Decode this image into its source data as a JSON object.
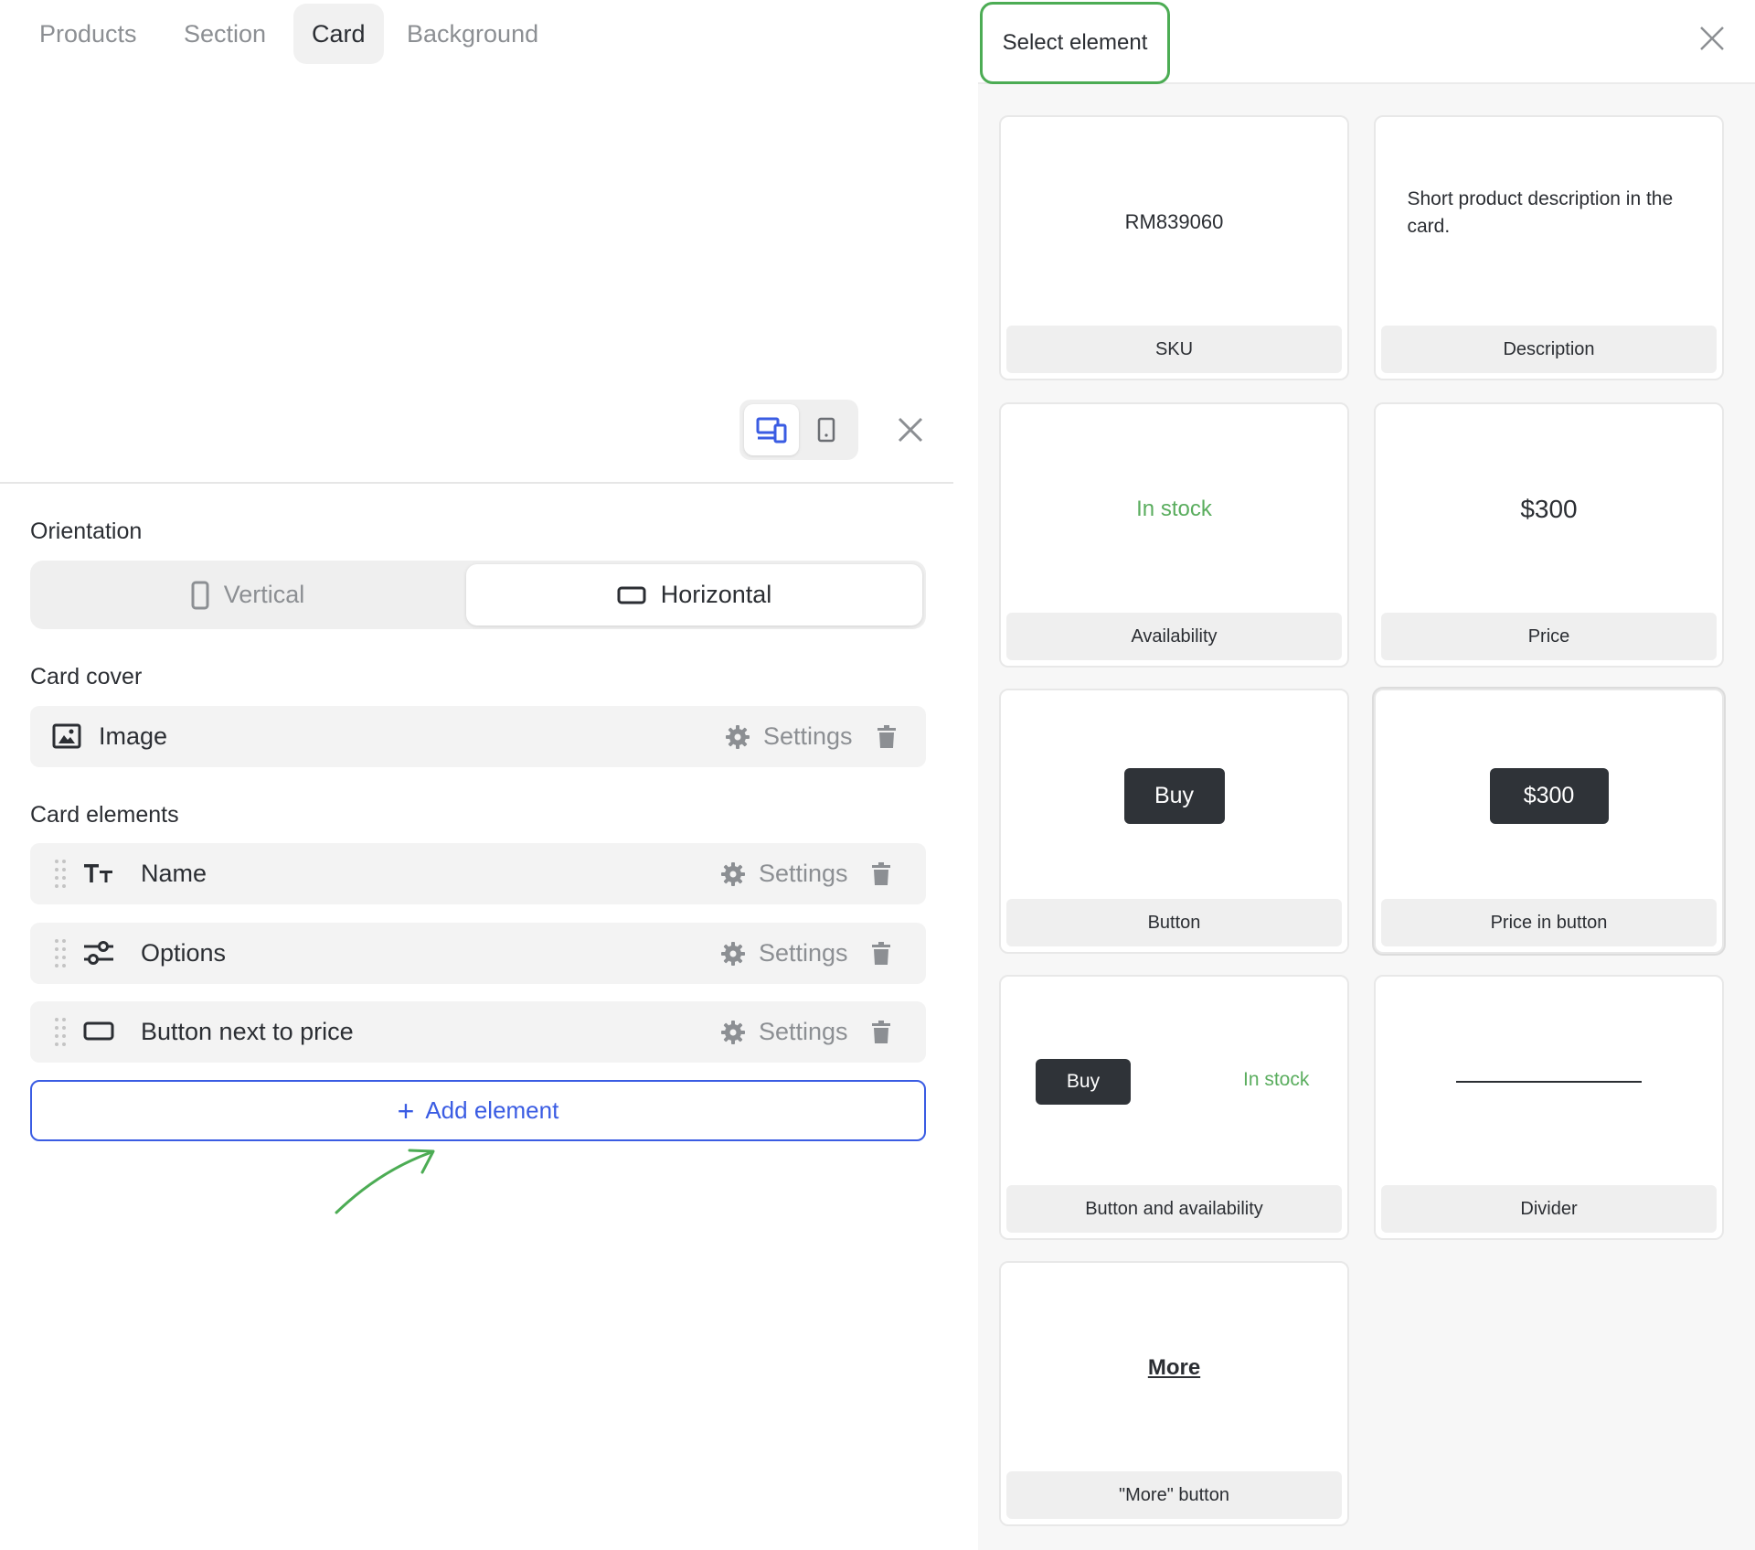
{
  "left": {
    "tabs": [
      {
        "label": "Products",
        "active": false
      },
      {
        "label": "Section",
        "active": false
      },
      {
        "label": "Card",
        "active": true
      },
      {
        "label": "Background",
        "active": false
      }
    ],
    "view_toggle": {
      "selected": "desktop"
    },
    "orientation": {
      "title": "Orientation",
      "options": [
        {
          "label": "Vertical",
          "selected": false
        },
        {
          "label": "Horizontal",
          "selected": true
        }
      ]
    },
    "card_cover": {
      "title": "Card cover",
      "item": {
        "label": "Image",
        "icon": "image-icon",
        "settings_label": "Settings"
      }
    },
    "card_elements": {
      "title": "Card elements",
      "items": [
        {
          "label": "Name",
          "icon": "text-size-icon",
          "settings_label": "Settings"
        },
        {
          "label": "Options",
          "icon": "sliders-icon",
          "settings_label": "Settings"
        },
        {
          "label": "Button next to price",
          "icon": "button-icon",
          "settings_label": "Settings"
        }
      ]
    },
    "add_element_label": "Add element"
  },
  "right": {
    "title": "Select element",
    "elements": [
      {
        "preview": "RM839060",
        "label": "SKU"
      },
      {
        "preview": "Short product description in the card.",
        "label": "Description"
      },
      {
        "preview": "In stock",
        "label": "Availability"
      },
      {
        "preview": "$300",
        "label": "Price"
      },
      {
        "preview": "Buy",
        "label": "Button"
      },
      {
        "preview": "$300",
        "label": "Price in button"
      },
      {
        "preview_button": "Buy",
        "preview_status": "In stock",
        "label": "Button and availability"
      },
      {
        "label": "Divider"
      },
      {
        "preview": "More",
        "label": "\"More\" button"
      }
    ]
  },
  "colors": {
    "accent_blue": "#3a5ce3",
    "highlight_green": "#4cac54",
    "in_stock_green": "#5aad5e",
    "dark_button": "#2f3338"
  }
}
